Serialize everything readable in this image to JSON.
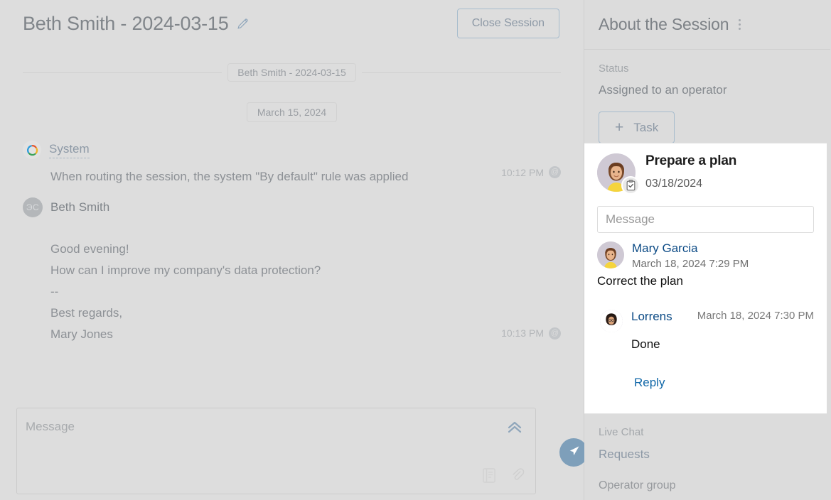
{
  "chat": {
    "title": "Beth Smith - 2024-03-15",
    "edit_icon": "pencil-icon",
    "close_session_label": "Close Session",
    "session_divider_label": "Beth Smith - 2024-03-15",
    "date_chip": "March 15, 2024",
    "messages": [
      {
        "author": "System",
        "author_type": "system",
        "avatar_icon": "bitrix-ring-icon",
        "text": "When routing the session, the system \"By default\" rule was applied",
        "time": "10:12 PM",
        "badge": "@"
      },
      {
        "author": "Beth Smith",
        "author_type": "client",
        "avatar_initials": "ЭС",
        "lines": [
          "Good evening!",
          "How can I improve my company's data protection?",
          "--",
          "Best regards,",
          "Mary Jones"
        ],
        "time": "10:13 PM",
        "badge": "@"
      }
    ],
    "composer": {
      "placeholder": "Message",
      "collapse_icon": "chevron-double-up-icon",
      "template_icon": "template-icon",
      "attach_icon": "paperclip-icon",
      "send_icon": "send-icon"
    }
  },
  "side": {
    "title": "About the Session",
    "menu_icon": "kebab-menu-icon",
    "status_label": "Status",
    "status_value": "Assigned to an operator",
    "task_button_label": "Task",
    "task_button_icon": "plus-icon",
    "task": {
      "title": "Prepare a plan",
      "date": "03/18/2024",
      "badge_icon": "clipboard-check-icon",
      "comment_placeholder": "Message",
      "comments": [
        {
          "name": "Mary Garcia",
          "time": "March 18, 2024 7:29 PM",
          "text": "Correct the plan"
        },
        {
          "name": "Lorrens",
          "time": "March 18, 2024 7:30 PM",
          "text": "Done"
        }
      ],
      "reply_label": "Reply"
    },
    "fields": {
      "live_chat_label": "Live Chat",
      "requests_link": "Requests",
      "operator_group_label": "Operator group"
    }
  },
  "colors": {
    "page_bg": "#dcdcdc",
    "card_bg": "#ffffff",
    "accent_blue": "#7e9fba",
    "link_blue": "#0b4a85",
    "muted_text": "#8d9196",
    "border": "#cfcfcf"
  }
}
